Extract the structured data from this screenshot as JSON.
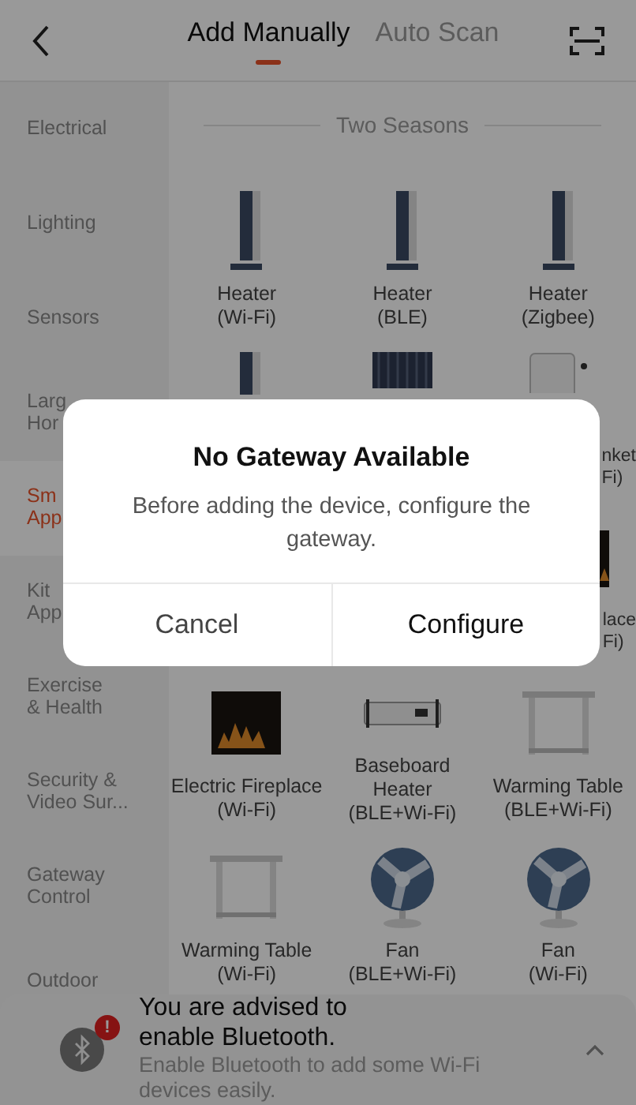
{
  "tabs": [
    {
      "label": "Add Manually",
      "selected": true
    },
    {
      "label": "Auto Scan",
      "selected": false
    }
  ],
  "sidebar": {
    "items": [
      {
        "label": "Electrical",
        "selected": false
      },
      {
        "label": "Lighting",
        "selected": false
      },
      {
        "label": "Sensors",
        "selected": false
      },
      {
        "label": "Larg\nHor",
        "selected": false
      },
      {
        "label": "Sm\nApp",
        "selected": true
      },
      {
        "label": "Kit\nApp",
        "selected": false
      },
      {
        "label": "Exercise\n& Health",
        "selected": false
      },
      {
        "label": "Security &\nVideo Sur...",
        "selected": false
      },
      {
        "label": "Gateway\nControl",
        "selected": false
      },
      {
        "label": "Outdoor",
        "selected": false
      }
    ]
  },
  "section_title": "Two Seasons",
  "devices": [
    {
      "kind": "heater",
      "label": "Heater\n(Wi-Fi)"
    },
    {
      "kind": "heater",
      "label": "Heater\n(BLE)"
    },
    {
      "kind": "heater",
      "label": "Heater\n(Zigbee)"
    },
    {
      "kind": "heater_top"
    },
    {
      "kind": "radiator_top"
    },
    {
      "kind": "blanket_top",
      "label": "nket\nFi)",
      "clipped": true
    },
    {
      "kind": "covered"
    },
    {
      "kind": "covered"
    },
    {
      "kind": "fireplace_edge",
      "label": "lace\nFi)",
      "clipped": true
    },
    {
      "kind": "fireplace",
      "label": "Electric Fireplace\n(Wi-Fi)"
    },
    {
      "kind": "baseboard",
      "label": "Baseboard\nHeater\n(BLE+Wi-Fi)"
    },
    {
      "kind": "table",
      "label": "Warming Table\n(BLE+Wi-Fi)"
    },
    {
      "kind": "table",
      "label": "Warming Table\n(Wi-Fi)"
    },
    {
      "kind": "fan",
      "label": "Fan\n(BLE+Wi-Fi)"
    },
    {
      "kind": "fan",
      "label": "Fan\n(Wi-Fi)"
    }
  ],
  "banner": {
    "title": "You are advised to\nenable Bluetooth.",
    "message": "Enable Bluetooth to add some Wi-Fi\ndevices easily.",
    "badge": "!"
  },
  "dialog": {
    "title": "No Gateway Available",
    "message": "Before adding the device, configure the gateway.",
    "buttons": [
      "Cancel",
      "Configure"
    ]
  }
}
